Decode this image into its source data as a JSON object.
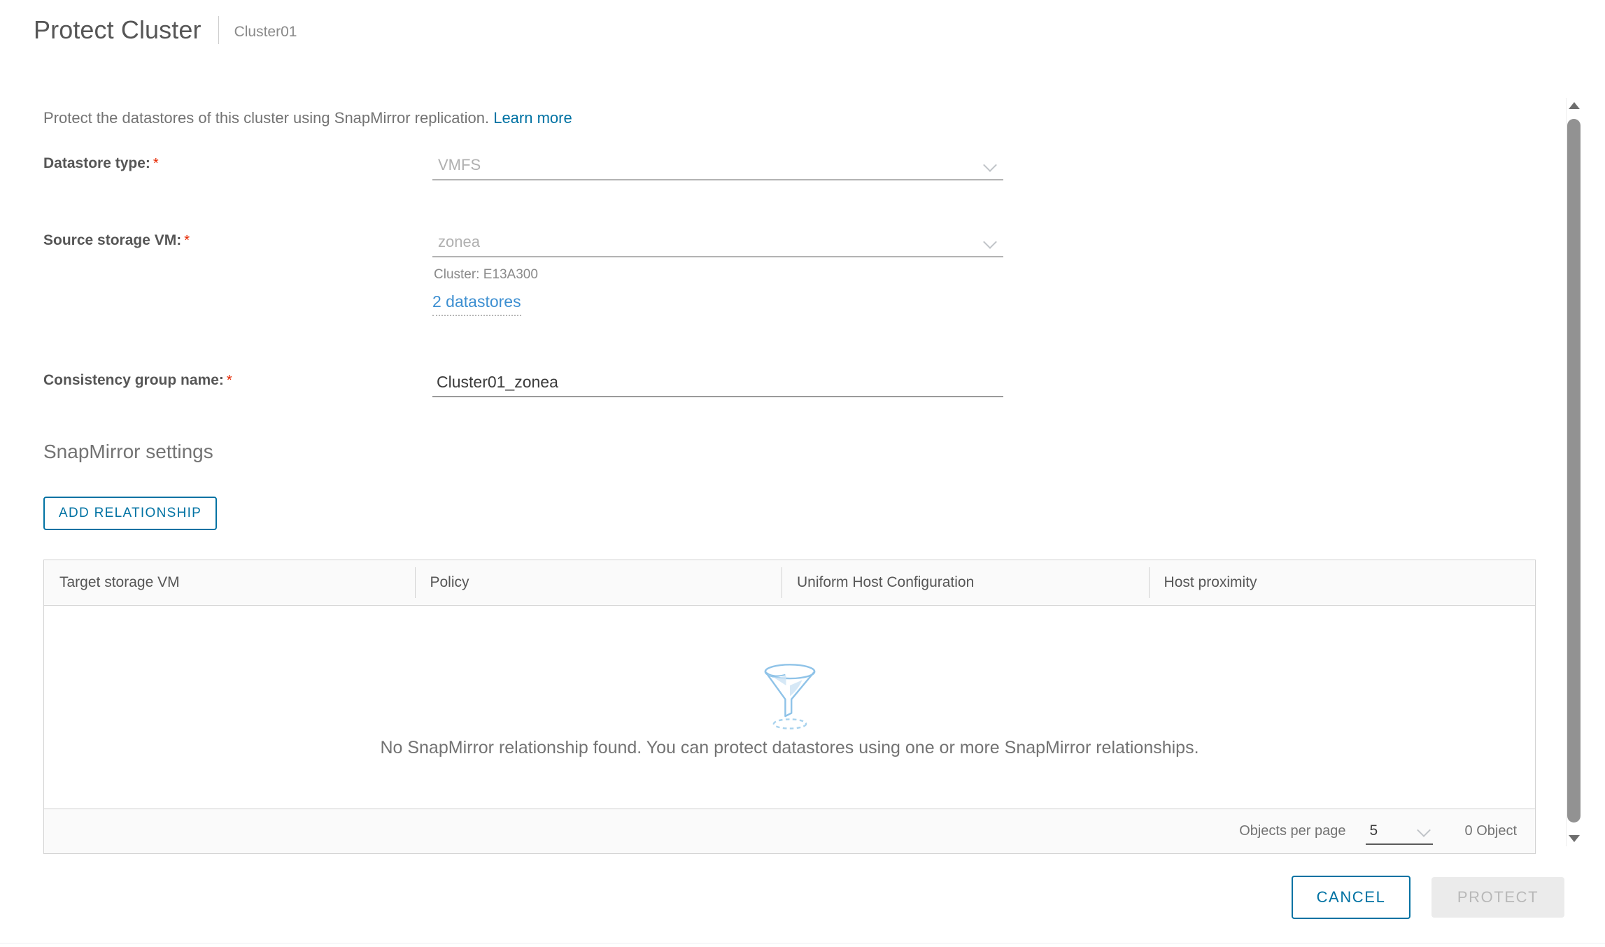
{
  "header": {
    "title": "Protect Cluster",
    "subtitle": "Cluster01"
  },
  "intro": {
    "text": "Protect the datastores of this cluster using SnapMirror replication.",
    "link_label": "Learn more"
  },
  "form": {
    "datastore_type": {
      "label": "Datastore type:",
      "required": "*",
      "value": "VMFS",
      "icon": "chevron-down-icon"
    },
    "source_storage_vm": {
      "label": "Source storage VM:",
      "required": "*",
      "value": "zonea",
      "icon": "chevron-down-icon",
      "cluster_note": "Cluster: E13A300",
      "datastores_link": "2 datastores"
    },
    "consistency_group_name": {
      "label": "Consistency group name:",
      "required": "*",
      "value": "Cluster01_zonea",
      "placeholder": ""
    }
  },
  "snapmirror": {
    "section_title": "SnapMirror settings",
    "add_relationship_label": "ADD RELATIONSHIP"
  },
  "table": {
    "columns": [
      "Target storage VM",
      "Policy",
      "Uniform Host Configuration",
      "Host proximity"
    ],
    "rows": [],
    "empty_icon": "funnel-filter-icon",
    "empty_message": "No SnapMirror relationship found. You can protect datastores using one or more SnapMirror relationships.",
    "footer": {
      "objects_per_page_label": "Objects per page",
      "page_size_value": "5",
      "page_size_icon": "chevron-down-icon",
      "total_label": "0 Object"
    }
  },
  "footer": {
    "cancel_label": "CANCEL",
    "protect_label": "PROTECT"
  },
  "scrollbar": {
    "up_icon": "caret-up-icon",
    "down_icon": "caret-down-icon"
  },
  "colors": {
    "accent": "#0072a3",
    "link": "#3d8fd1",
    "required": "#e62700",
    "text": "#565656",
    "muted": "#8a8a8a"
  }
}
